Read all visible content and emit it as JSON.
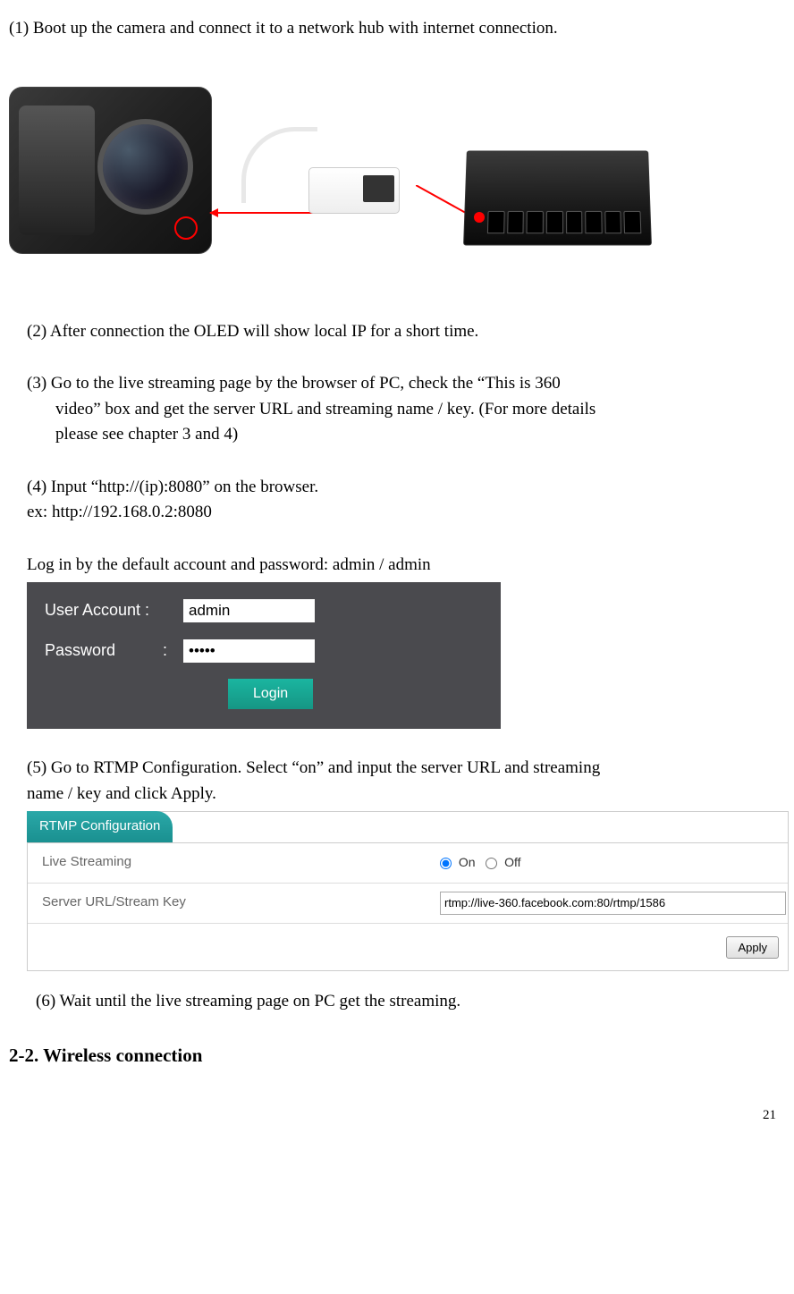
{
  "steps": {
    "s1": "(1) Boot up the camera and connect it to a network hub with internet connection.",
    "s2": "(2) After connection the OLED will show local IP for a short time.",
    "s3_a": "(3) Go to the live streaming page by the browser of PC, check the “This is 360",
    "s3_b": "video” box and get the server URL and streaming name / key. (For more details",
    "s3_c": "please see chapter 3 and 4)",
    "s4": "(4) Input “http://(ip):8080” on the browser.",
    "s4_ex": "ex: http://192.168.0.2:8080",
    "s4_login_hint": "Log in by the default account and password: admin / admin",
    "s5_a": "(5) Go to RTMP Configuration. Select “on” and input the server URL and streaming",
    "s5_b": "name / key and click Apply.",
    "s6": "(6) Wait until the live streaming page on PC get the streaming."
  },
  "login": {
    "user_label": "User Account :",
    "pass_label": "Password",
    "pass_colon": ":",
    "user_value": "admin",
    "pass_value": "•••••",
    "button": "Login"
  },
  "rtmp": {
    "header": "RTMP Configuration",
    "row1_label": "Live Streaming",
    "on_label": "On",
    "off_label": "Off",
    "row2_label": "Server URL/Stream Key",
    "url_value": "rtmp://live-360.facebook.com:80/rtmp/1586",
    "apply": "Apply"
  },
  "section": "2-2. Wireless connection",
  "page_number": "21"
}
